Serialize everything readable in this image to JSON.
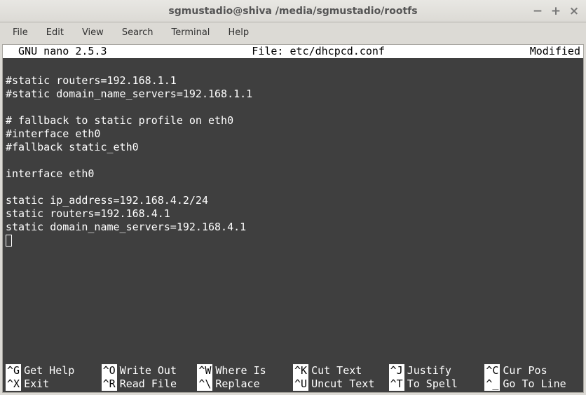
{
  "window": {
    "title": "sgmustadio@shiva /media/sgmustadio/rootfs"
  },
  "menubar": {
    "items": [
      "File",
      "Edit",
      "View",
      "Search",
      "Terminal",
      "Help"
    ]
  },
  "nano": {
    "status_left": "  GNU nano 2.5.3",
    "status_center": "File: etc/dhcpcd.conf",
    "status_right": "Modified",
    "content_lines": [
      "",
      "#static routers=192.168.1.1",
      "#static domain_name_servers=192.168.1.1",
      "",
      "# fallback to static profile on eth0",
      "#interface eth0",
      "#fallback static_eth0",
      "",
      "interface eth0",
      "",
      "static ip_address=192.168.4.2/24",
      "static routers=192.168.4.1",
      "static domain_name_servers=192.168.4.1"
    ],
    "shortcuts": [
      {
        "key": "^G",
        "label": "Get Help"
      },
      {
        "key": "^O",
        "label": "Write Out"
      },
      {
        "key": "^W",
        "label": "Where Is"
      },
      {
        "key": "^K",
        "label": "Cut Text"
      },
      {
        "key": "^J",
        "label": "Justify"
      },
      {
        "key": "^C",
        "label": "Cur Pos"
      },
      {
        "key": "^X",
        "label": "Exit"
      },
      {
        "key": "^R",
        "label": "Read File"
      },
      {
        "key": "^\\",
        "label": "Replace"
      },
      {
        "key": "^U",
        "label": "Uncut Text"
      },
      {
        "key": "^T",
        "label": "To Spell"
      },
      {
        "key": "^_",
        "label": "Go To Line"
      }
    ]
  }
}
